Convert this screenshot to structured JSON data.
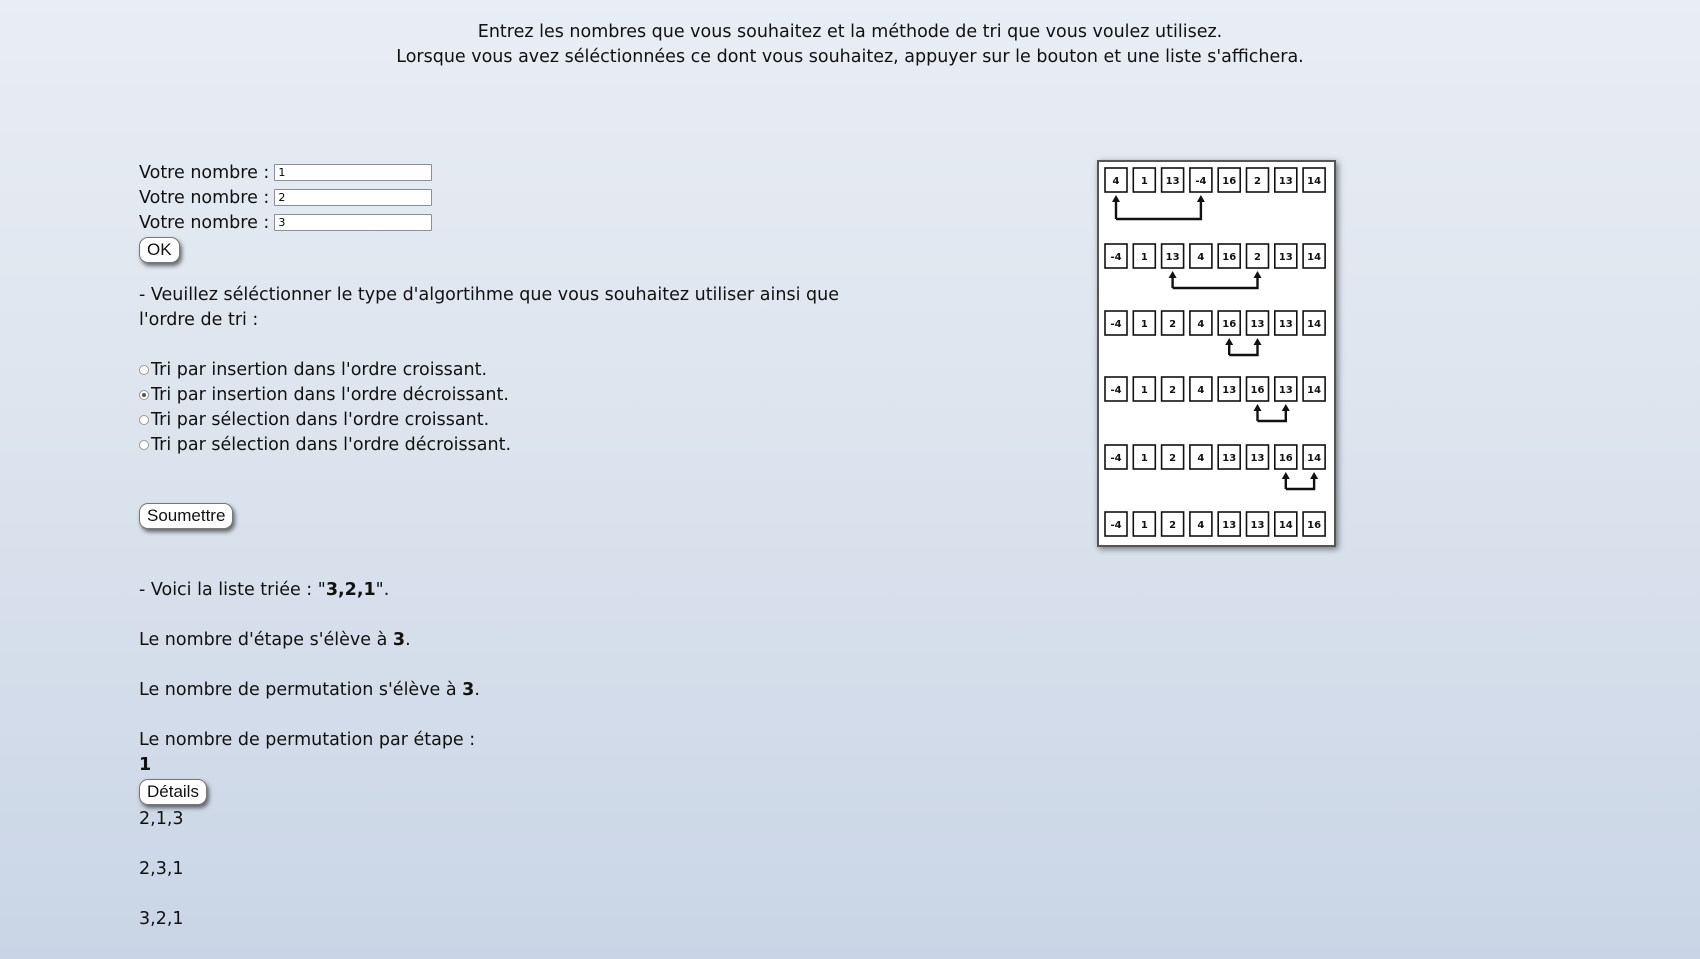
{
  "intro": {
    "line1": "Entrez les nombres que vous souhaitez et la méthode de tri que vous voulez utilisez.",
    "line2": "Lorsque vous avez séléctionnées ce dont vous souhaitez, appuyer sur le bouton et une liste s'affichera."
  },
  "number_inputs": [
    {
      "label": "Votre nombre :",
      "value": "1"
    },
    {
      "label": "Votre nombre :",
      "value": "2"
    },
    {
      "label": "Votre nombre :",
      "value": "3"
    }
  ],
  "ok_label": "OK",
  "algo_question": "- Veuillez séléctionner le type d'algortihme que vous souhaitez utiliser ainsi que l'ordre de tri :",
  "radio_options": [
    {
      "label": "Tri par insertion dans l'ordre croissant.",
      "checked": false
    },
    {
      "label": "Tri par insertion dans l'ordre décroissant.",
      "checked": true
    },
    {
      "label": "Tri par sélection dans l'ordre croissant.",
      "checked": false
    },
    {
      "label": "Tri par sélection dans l'ordre décroissant.",
      "checked": false
    }
  ],
  "submit_label": "Soumettre",
  "results": {
    "sorted_prefix": "- Voici la liste triée : \"",
    "sorted_value": "3,2,1",
    "sorted_suffix": "\".",
    "steps_prefix": "Le nombre d'étape s'élève à ",
    "steps_value": "3",
    "steps_suffix": ".",
    "perm_prefix": "Le nombre de permutation s'élève à ",
    "perm_value": "3",
    "perm_suffix": ".",
    "perm_per_step_label": "Le nombre de permutation par étape :",
    "perm_per_step_value": "1",
    "details_label": "Détails",
    "detail_lists": [
      "2,1,3",
      "2,3,1",
      "3,2,1"
    ]
  },
  "illustration": {
    "rows": [
      [
        "4",
        "1",
        "13",
        "-4",
        "16",
        "2",
        "13",
        "14"
      ],
      [
        "-4",
        "1",
        "13",
        "4",
        "16",
        "2",
        "13",
        "14"
      ],
      [
        "-4",
        "1",
        "2",
        "4",
        "16",
        "13",
        "13",
        "14"
      ],
      [
        "-4",
        "1",
        "2",
        "4",
        "13",
        "16",
        "13",
        "14"
      ],
      [
        "-4",
        "1",
        "2",
        "4",
        "13",
        "13",
        "16",
        "14"
      ],
      [
        "-4",
        "1",
        "2",
        "4",
        "13",
        "13",
        "14",
        "16"
      ]
    ],
    "swaps": [
      [
        0,
        3
      ],
      [
        2,
        5
      ],
      [
        4,
        5
      ],
      [
        5,
        6
      ],
      [
        6,
        7
      ]
    ]
  }
}
